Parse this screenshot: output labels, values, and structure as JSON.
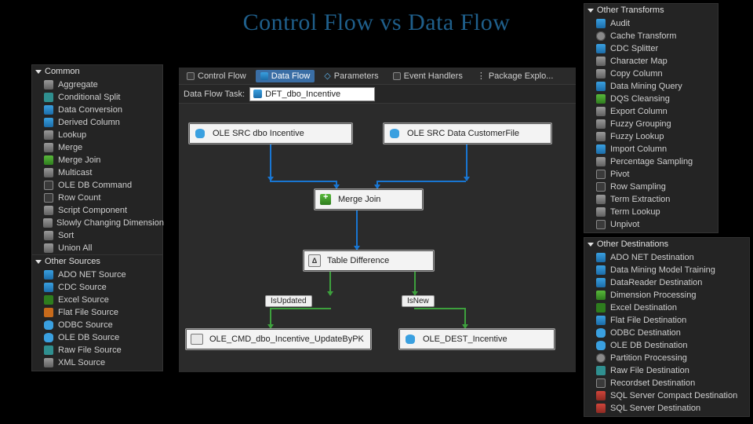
{
  "title": "Control Flow vs Data Flow",
  "panels": {
    "common": {
      "title": "Common",
      "items": [
        {
          "label": "Aggregate",
          "ico": "g-gray"
        },
        {
          "label": "Conditional Split",
          "ico": "g-teal"
        },
        {
          "label": "Data Conversion",
          "ico": "g-blue"
        },
        {
          "label": "Derived Column",
          "ico": "g-blue"
        },
        {
          "label": "Lookup",
          "ico": "g-gray"
        },
        {
          "label": "Merge",
          "ico": "g-gray"
        },
        {
          "label": "Merge Join",
          "ico": "g-green"
        },
        {
          "label": "Multicast",
          "ico": "g-gray"
        },
        {
          "label": "OLE DB Command",
          "ico": "g-box"
        },
        {
          "label": "Row Count",
          "ico": "g-box"
        },
        {
          "label": "Script Component",
          "ico": "g-gray"
        },
        {
          "label": "Slowly Changing Dimension",
          "ico": "g-gray"
        },
        {
          "label": "Sort",
          "ico": "g-gray"
        },
        {
          "label": "Union All",
          "ico": "g-gray"
        }
      ]
    },
    "otherSources": {
      "title": "Other Sources",
      "items": [
        {
          "label": "ADO NET Source",
          "ico": "g-blue"
        },
        {
          "label": "CDC Source",
          "ico": "g-blue"
        },
        {
          "label": "Excel Source",
          "ico": "g-xls"
        },
        {
          "label": "Flat File Source",
          "ico": "g-orange"
        },
        {
          "label": "ODBC Source",
          "ico": "g-cyl"
        },
        {
          "label": "OLE DB Source",
          "ico": "g-cyl"
        },
        {
          "label": "Raw File Source",
          "ico": "g-teal"
        },
        {
          "label": "XML Source",
          "ico": "g-gray"
        }
      ]
    },
    "otherTransforms": {
      "title": "Other Transforms",
      "items": [
        {
          "label": "Audit",
          "ico": "g-blue"
        },
        {
          "label": "Cache Transform",
          "ico": "g-gear"
        },
        {
          "label": "CDC Splitter",
          "ico": "g-blue"
        },
        {
          "label": "Character Map",
          "ico": "g-gray"
        },
        {
          "label": "Copy Column",
          "ico": "g-gray"
        },
        {
          "label": "Data Mining Query",
          "ico": "g-blue"
        },
        {
          "label": "DQS Cleansing",
          "ico": "g-green"
        },
        {
          "label": "Export Column",
          "ico": "g-gray"
        },
        {
          "label": "Fuzzy Grouping",
          "ico": "g-gray"
        },
        {
          "label": "Fuzzy Lookup",
          "ico": "g-gray"
        },
        {
          "label": "Import Column",
          "ico": "g-blue"
        },
        {
          "label": "Percentage Sampling",
          "ico": "g-gray"
        },
        {
          "label": "Pivot",
          "ico": "g-box"
        },
        {
          "label": "Row Sampling",
          "ico": "g-box"
        },
        {
          "label": "Term Extraction",
          "ico": "g-gray"
        },
        {
          "label": "Term Lookup",
          "ico": "g-gray"
        },
        {
          "label": "Unpivot",
          "ico": "g-box"
        }
      ]
    },
    "otherDestinations": {
      "title": "Other Destinations",
      "items": [
        {
          "label": "ADO NET Destination",
          "ico": "g-blue"
        },
        {
          "label": "Data Mining Model Training",
          "ico": "g-blue"
        },
        {
          "label": "DataReader Destination",
          "ico": "g-blue"
        },
        {
          "label": "Dimension Processing",
          "ico": "g-green"
        },
        {
          "label": "Excel Destination",
          "ico": "g-xls"
        },
        {
          "label": "Flat File Destination",
          "ico": "g-blue"
        },
        {
          "label": "ODBC Destination",
          "ico": "g-cyl"
        },
        {
          "label": "OLE DB Destination",
          "ico": "g-cyl"
        },
        {
          "label": "Partition Processing",
          "ico": "g-gear"
        },
        {
          "label": "Raw File Destination",
          "ico": "g-teal"
        },
        {
          "label": "Recordset Destination",
          "ico": "g-box"
        },
        {
          "label": "SQL Server Compact Destination",
          "ico": "g-red"
        },
        {
          "label": "SQL Server Destination",
          "ico": "g-red"
        }
      ]
    }
  },
  "designer": {
    "tabs": {
      "controlFlow": "Control Flow",
      "dataFlow": "Data Flow",
      "parameters": "Parameters",
      "eventHandlers": "Event Handlers",
      "packageExplorer": "Package Explo..."
    },
    "taskLabel": "Data Flow Task:",
    "taskName": "DFT_dbo_Incentive",
    "nodes": {
      "src1": "OLE SRC dbo Incentive",
      "src2": "OLE SRC Data CustomerFile",
      "mergeJoin": "Merge Join",
      "tableDiff": "Table Difference",
      "isUpdated": "IsUpdated",
      "isNew": "IsNew",
      "updateCmd": "OLE_CMD_dbo_Incentive_UpdateByPK",
      "dest": "OLE_DEST_Incentive"
    }
  }
}
